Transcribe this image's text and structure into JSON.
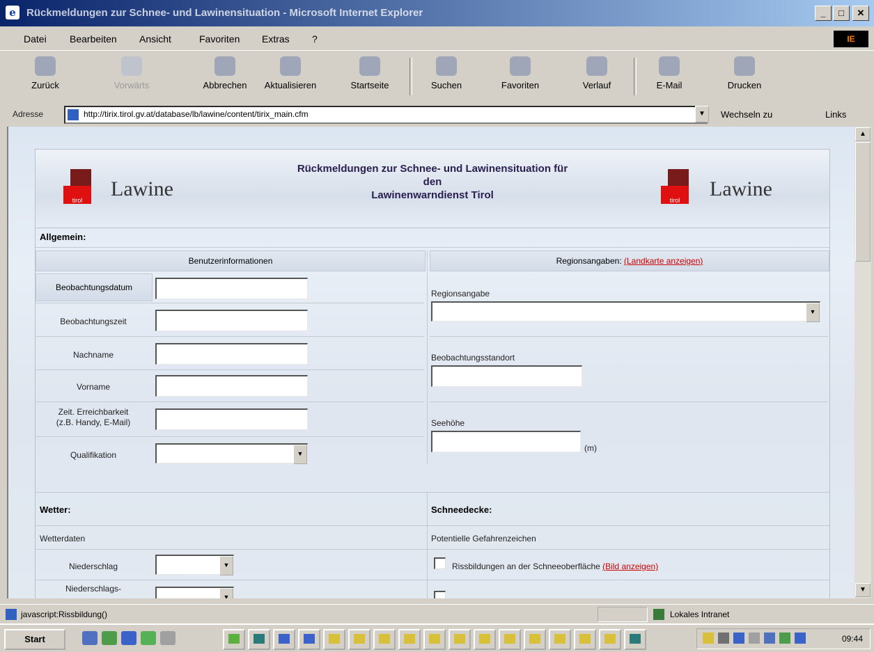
{
  "window": {
    "title": "Rückmeldungen zur Schnee- und Lawinensituation - Microsoft Internet Explorer",
    "controls": [
      "_",
      "□",
      "✕"
    ]
  },
  "menu": [
    "Datei",
    "Bearbeiten",
    "Ansicht",
    "Favoriten",
    "Extras",
    "?"
  ],
  "toolbar": {
    "back": "Zurück",
    "forward": "Vorwärts",
    "stop": "Abbrechen",
    "refresh": "Aktualisieren",
    "home": "Startseite",
    "search": "Suchen",
    "favorites": "Favoriten",
    "history": "Verlauf",
    "mail": "E-Mail",
    "print": "Drucken"
  },
  "address": {
    "label": "Adresse",
    "url": "http://tirix.tirol.gv.at/database/lb/lawine/content/tirix_main.cfm",
    "go": "Wechseln zu",
    "links": "Links"
  },
  "page": {
    "logo_text": "Lawine",
    "emblem_text": "tirol",
    "banner_line1": "Rückmeldungen zur Schnee- und Lawinensituation für",
    "banner_line2": "den",
    "banner_line3": "Lawinenwarndienst Tirol",
    "section_general": "Allgemein:",
    "user_info_header": "Benutzerinformationen",
    "region_header": "Regionsangaben:",
    "region_map_link": "(Landkarte anzeigen)",
    "fields": {
      "obs_date": "Beobachtungsdatum",
      "obs_time": "Beobachtungszeit",
      "lastname": "Nachname",
      "firstname": "Vorname",
      "reach_line1": "Zeit. Erreichbarkeit",
      "reach_line2": "(z.B. Handy, E-Mail)",
      "qualification": "Qualifikation"
    },
    "region_label": "Regionsangabe",
    "location_label": "Beobachtungsstandort",
    "altitude_label": "Seehöhe",
    "altitude_unit": "(m)",
    "section_weather": "Wetter:",
    "section_snow": "Schneedecke:",
    "weather_data": "Wetterdaten",
    "danger_signs": "Potentielle Gefahrenzeichen",
    "precip": "Niederschlag",
    "precip_amount": "Niederschlags-",
    "surface_check": "Rissbildungen an der Schneeoberfläche",
    "show_image_link": "(Bild anzeigen)"
  },
  "status": {
    "text": "javascript:Rissbildung()",
    "zone": "Lokales Intranet"
  },
  "taskbar": {
    "start": "Start",
    "clock": "09:44"
  }
}
